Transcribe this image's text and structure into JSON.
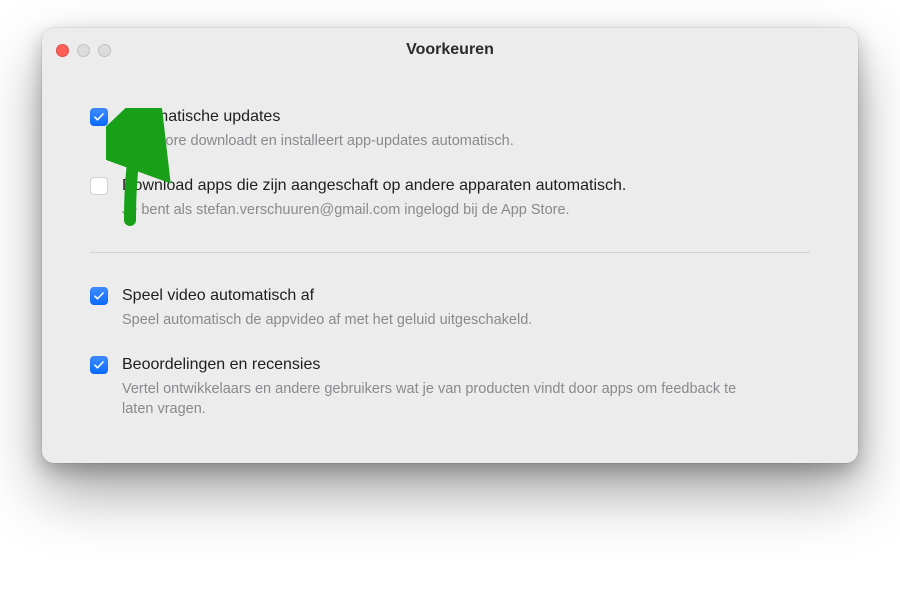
{
  "window": {
    "title": "Voorkeuren"
  },
  "options": [
    {
      "checked": true,
      "label": "Automatische updates",
      "desc": "App Store downloadt en installeert app-updates automatisch."
    },
    {
      "checked": false,
      "label": "Download apps die zijn aangeschaft op andere apparaten automatisch.",
      "desc": "Je bent als stefan.verschuuren@gmail.com ingelogd bij de App Store."
    },
    {
      "checked": true,
      "label": "Speel video automatisch af",
      "desc": "Speel automatisch de appvideo af met het geluid uitgeschakeld."
    },
    {
      "checked": true,
      "label": "Beoordelingen en recensies",
      "desc": "Vertel ontwikkelaars en andere gebruikers wat je van producten vindt door apps om feedback te laten vragen."
    }
  ],
  "annotation": {
    "arrow_color": "#18a018"
  }
}
